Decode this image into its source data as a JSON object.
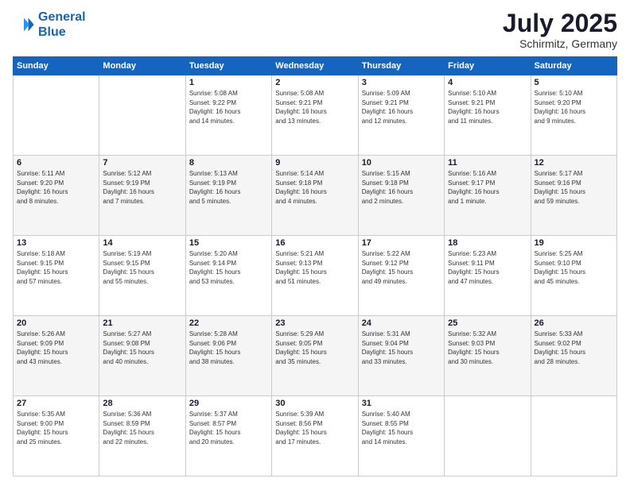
{
  "header": {
    "logo_line1": "General",
    "logo_line2": "Blue",
    "month": "July 2025",
    "location": "Schirmitz, Germany"
  },
  "weekdays": [
    "Sunday",
    "Monday",
    "Tuesday",
    "Wednesday",
    "Thursday",
    "Friday",
    "Saturday"
  ],
  "weeks": [
    [
      {
        "day": "",
        "info": ""
      },
      {
        "day": "",
        "info": ""
      },
      {
        "day": "1",
        "info": "Sunrise: 5:08 AM\nSunset: 9:22 PM\nDaylight: 16 hours\nand 14 minutes."
      },
      {
        "day": "2",
        "info": "Sunrise: 5:08 AM\nSunset: 9:21 PM\nDaylight: 16 hours\nand 13 minutes."
      },
      {
        "day": "3",
        "info": "Sunrise: 5:09 AM\nSunset: 9:21 PM\nDaylight: 16 hours\nand 12 minutes."
      },
      {
        "day": "4",
        "info": "Sunrise: 5:10 AM\nSunset: 9:21 PM\nDaylight: 16 hours\nand 11 minutes."
      },
      {
        "day": "5",
        "info": "Sunrise: 5:10 AM\nSunset: 9:20 PM\nDaylight: 16 hours\nand 9 minutes."
      }
    ],
    [
      {
        "day": "6",
        "info": "Sunrise: 5:11 AM\nSunset: 9:20 PM\nDaylight: 16 hours\nand 8 minutes."
      },
      {
        "day": "7",
        "info": "Sunrise: 5:12 AM\nSunset: 9:19 PM\nDaylight: 16 hours\nand 7 minutes."
      },
      {
        "day": "8",
        "info": "Sunrise: 5:13 AM\nSunset: 9:19 PM\nDaylight: 16 hours\nand 5 minutes."
      },
      {
        "day": "9",
        "info": "Sunrise: 5:14 AM\nSunset: 9:18 PM\nDaylight: 16 hours\nand 4 minutes."
      },
      {
        "day": "10",
        "info": "Sunrise: 5:15 AM\nSunset: 9:18 PM\nDaylight: 16 hours\nand 2 minutes."
      },
      {
        "day": "11",
        "info": "Sunrise: 5:16 AM\nSunset: 9:17 PM\nDaylight: 16 hours\nand 1 minute."
      },
      {
        "day": "12",
        "info": "Sunrise: 5:17 AM\nSunset: 9:16 PM\nDaylight: 15 hours\nand 59 minutes."
      }
    ],
    [
      {
        "day": "13",
        "info": "Sunrise: 5:18 AM\nSunset: 9:15 PM\nDaylight: 15 hours\nand 57 minutes."
      },
      {
        "day": "14",
        "info": "Sunrise: 5:19 AM\nSunset: 9:15 PM\nDaylight: 15 hours\nand 55 minutes."
      },
      {
        "day": "15",
        "info": "Sunrise: 5:20 AM\nSunset: 9:14 PM\nDaylight: 15 hours\nand 53 minutes."
      },
      {
        "day": "16",
        "info": "Sunrise: 5:21 AM\nSunset: 9:13 PM\nDaylight: 15 hours\nand 51 minutes."
      },
      {
        "day": "17",
        "info": "Sunrise: 5:22 AM\nSunset: 9:12 PM\nDaylight: 15 hours\nand 49 minutes."
      },
      {
        "day": "18",
        "info": "Sunrise: 5:23 AM\nSunset: 9:11 PM\nDaylight: 15 hours\nand 47 minutes."
      },
      {
        "day": "19",
        "info": "Sunrise: 5:25 AM\nSunset: 9:10 PM\nDaylight: 15 hours\nand 45 minutes."
      }
    ],
    [
      {
        "day": "20",
        "info": "Sunrise: 5:26 AM\nSunset: 9:09 PM\nDaylight: 15 hours\nand 43 minutes."
      },
      {
        "day": "21",
        "info": "Sunrise: 5:27 AM\nSunset: 9:08 PM\nDaylight: 15 hours\nand 40 minutes."
      },
      {
        "day": "22",
        "info": "Sunrise: 5:28 AM\nSunset: 9:06 PM\nDaylight: 15 hours\nand 38 minutes."
      },
      {
        "day": "23",
        "info": "Sunrise: 5:29 AM\nSunset: 9:05 PM\nDaylight: 15 hours\nand 35 minutes."
      },
      {
        "day": "24",
        "info": "Sunrise: 5:31 AM\nSunset: 9:04 PM\nDaylight: 15 hours\nand 33 minutes."
      },
      {
        "day": "25",
        "info": "Sunrise: 5:32 AM\nSunset: 9:03 PM\nDaylight: 15 hours\nand 30 minutes."
      },
      {
        "day": "26",
        "info": "Sunrise: 5:33 AM\nSunset: 9:02 PM\nDaylight: 15 hours\nand 28 minutes."
      }
    ],
    [
      {
        "day": "27",
        "info": "Sunrise: 5:35 AM\nSunset: 9:00 PM\nDaylight: 15 hours\nand 25 minutes."
      },
      {
        "day": "28",
        "info": "Sunrise: 5:36 AM\nSunset: 8:59 PM\nDaylight: 15 hours\nand 22 minutes."
      },
      {
        "day": "29",
        "info": "Sunrise: 5:37 AM\nSunset: 8:57 PM\nDaylight: 15 hours\nand 20 minutes."
      },
      {
        "day": "30",
        "info": "Sunrise: 5:39 AM\nSunset: 8:56 PM\nDaylight: 15 hours\nand 17 minutes."
      },
      {
        "day": "31",
        "info": "Sunrise: 5:40 AM\nSunset: 8:55 PM\nDaylight: 15 hours\nand 14 minutes."
      },
      {
        "day": "",
        "info": ""
      },
      {
        "day": "",
        "info": ""
      }
    ]
  ]
}
